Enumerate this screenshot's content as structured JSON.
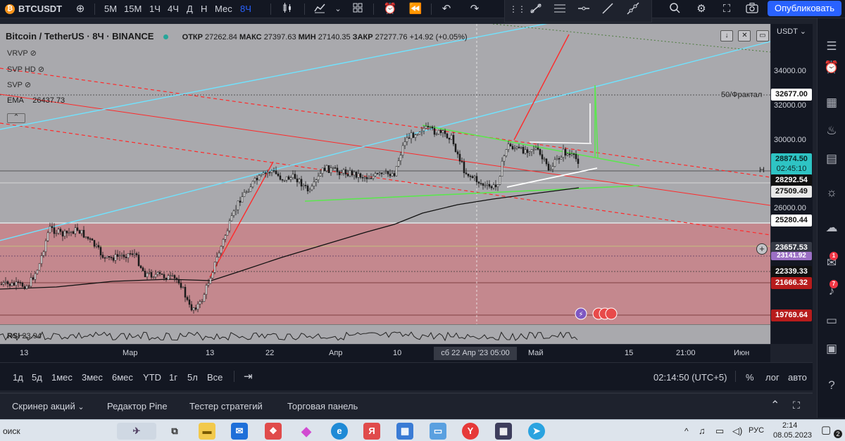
{
  "toolbar": {
    "symbol": "BTCUSDT",
    "intervals": [
      "5М",
      "15М",
      "1Ч",
      "4Ч",
      "Д",
      "Н",
      "Мес",
      "8Ч"
    ],
    "active_interval": "8Ч",
    "publish_label": "Опубликовать"
  },
  "legend": {
    "title": "Bitcoin / TetherUS · 8Ч · BINANCE",
    "open_label": "ОТКР",
    "open": "27262.84",
    "high_label": "МАКС",
    "high": "27397.63",
    "low_label": "МИН",
    "low": "27140.35",
    "close_label": "ЗАКР",
    "close": "27277.76",
    "change": "+14.92 (+0.05%)"
  },
  "indicators": [
    "VRVP",
    "SVP HD",
    "SVP"
  ],
  "ema": {
    "label": "EMA",
    "value": "26437.73"
  },
  "fractal_label": "50/Фрактал",
  "h_marker": "H",
  "rsi": {
    "label": "RSI",
    "value": "23.94"
  },
  "price_scale": {
    "currency": "USDT",
    "ticks": [
      "34000.00",
      "32000.00",
      "30000.00",
      "26000.00"
    ],
    "badges": {
      "level_upper": "32677.00",
      "last_price": "28874.50",
      "countdown": "02:45:10",
      "level_a": "28292.54",
      "level_b": "27509.49",
      "level_c": "25280.44",
      "crosshair": "23657.53",
      "level_d": "23141.92",
      "level_e": "22339.33",
      "level_f": "21666.32",
      "level_g": "19769.64"
    }
  },
  "time_axis": {
    "labels": [
      "13",
      "Мар",
      "13",
      "22",
      "Апр",
      "10",
      "Май",
      "15",
      "21:00",
      "Июн"
    ],
    "cursor": "сб 22 Апр '23   05:00"
  },
  "range_bar": {
    "ranges": [
      "1д",
      "5д",
      "1мес",
      "3мес",
      "6мес",
      "YTD",
      "1г",
      "5л",
      "Все"
    ],
    "clock": "02:14:50 (UTC+5)",
    "percent": "%",
    "log": "лог",
    "auto": "авто"
  },
  "bottom_panel": {
    "tabs": [
      "Скринер акций",
      "Редактор Pine",
      "Тестер стратегий",
      "Торговая панель"
    ]
  },
  "right_widgets": {
    "badge_chat": "1",
    "badge_alerts": "7"
  },
  "taskbar": {
    "search": "оиск",
    "lang": "РУС",
    "time": "2:14",
    "date": "08.05.2023",
    "notif_count": "2"
  },
  "colors": {
    "accent": "#2962ff",
    "chart_bg": "#a9a9ad",
    "red_zone": "#c4888e",
    "green_line": "#5ce64f",
    "cyan_line": "#6fe3ff",
    "red_line": "#ff2a2a"
  }
}
